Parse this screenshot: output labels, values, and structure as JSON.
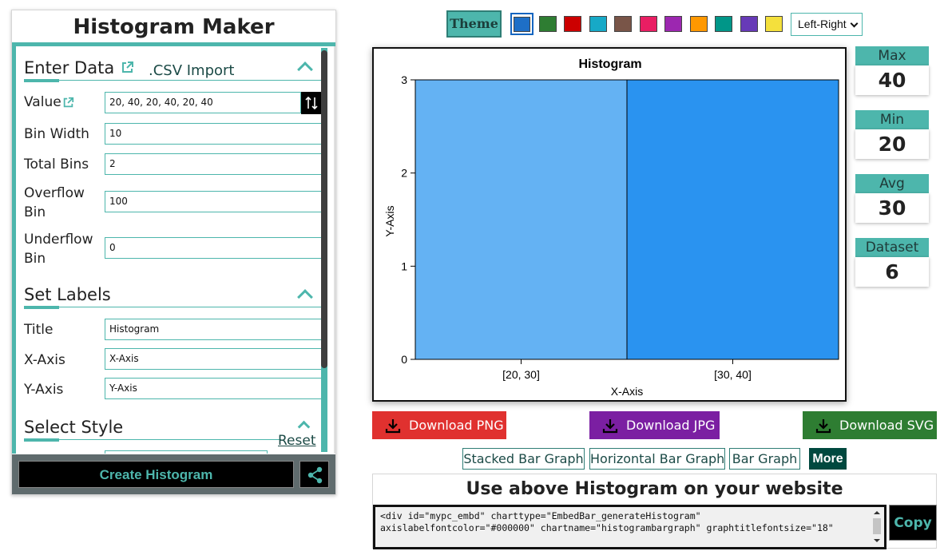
{
  "app": {
    "title": "Histogram Maker"
  },
  "data_section": {
    "title": "Enter Data",
    "csv_import": ".CSV Import",
    "fields": [
      {
        "label": "Value",
        "value": "20, 40, 20, 40, 20, 40"
      },
      {
        "label": "Bin Width",
        "value": "10"
      },
      {
        "label": "Total Bins",
        "value": "2"
      },
      {
        "label": "Overflow Bin",
        "value": "100"
      },
      {
        "label": "Underflow Bin",
        "value": "0"
      }
    ]
  },
  "labels_section": {
    "title": "Set Labels",
    "fields": [
      {
        "label": "Title",
        "value": "Histogram"
      },
      {
        "label": "X-Axis",
        "value": "X-Axis"
      },
      {
        "label": "Y-Axis",
        "value": "Y-Axis"
      }
    ]
  },
  "style_section": {
    "title": "Select Style",
    "reset": "Reset"
  },
  "actions": {
    "create": "Create Histogram"
  },
  "toolbar": {
    "theme": "Theme",
    "swatches": [
      "#1e6fc7",
      "#2e7d32",
      "#cc0000",
      "#17a9c7",
      "#795548",
      "#e91e63",
      "#9c27b0",
      "#ff9800",
      "#009688",
      "#673ab7",
      "#f4e03c"
    ],
    "layout_selected": "Left-Right"
  },
  "chart_data": {
    "type": "bar",
    "title": "Histogram",
    "xlabel": "X-Axis",
    "ylabel": "Y-Axis",
    "categories": [
      "[20, 30]",
      "[30, 40]"
    ],
    "values": [
      3,
      3
    ],
    "ylim": [
      0,
      3
    ],
    "yticks": [
      0,
      1,
      2,
      3
    ],
    "bar_colors": [
      "#64b2f3",
      "#2a93f0"
    ]
  },
  "stats": [
    {
      "label": "Max",
      "value": "40"
    },
    {
      "label": "Min",
      "value": "20"
    },
    {
      "label": "Avg",
      "value": "30"
    },
    {
      "label": "Dataset",
      "value": "6"
    }
  ],
  "downloads": [
    {
      "label": "Download PNG",
      "color": "#e0312f"
    },
    {
      "label": "Download JPG",
      "color": "#7b1fa2"
    },
    {
      "label": "Download SVG",
      "color": "#2e7d32"
    }
  ],
  "graph_links": [
    "Stacked Bar Graph",
    "Horizontal Bar Graph",
    "Bar Graph"
  ],
  "more": "More",
  "embed": {
    "title": "Use above Histogram on your website",
    "code": "<div id=\"mypc_embd\" charttype=\"EmbedBar_generateHistogram\"\naxislabelfontcolor=\"#000000\" chartname=\"histogrambargraph\" graphtitlefontsize=\"18\"",
    "copy": "Copy"
  }
}
